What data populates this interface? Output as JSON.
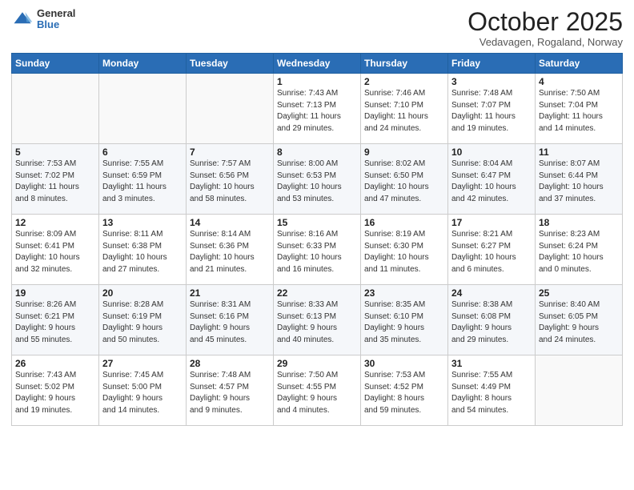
{
  "header": {
    "logo_general": "General",
    "logo_blue": "Blue",
    "month": "October 2025",
    "location": "Vedavagen, Rogaland, Norway"
  },
  "days_of_week": [
    "Sunday",
    "Monday",
    "Tuesday",
    "Wednesday",
    "Thursday",
    "Friday",
    "Saturday"
  ],
  "weeks": [
    [
      {
        "day": "",
        "info": ""
      },
      {
        "day": "",
        "info": ""
      },
      {
        "day": "",
        "info": ""
      },
      {
        "day": "1",
        "info": "Sunrise: 7:43 AM\nSunset: 7:13 PM\nDaylight: 11 hours\nand 29 minutes."
      },
      {
        "day": "2",
        "info": "Sunrise: 7:46 AM\nSunset: 7:10 PM\nDaylight: 11 hours\nand 24 minutes."
      },
      {
        "day": "3",
        "info": "Sunrise: 7:48 AM\nSunset: 7:07 PM\nDaylight: 11 hours\nand 19 minutes."
      },
      {
        "day": "4",
        "info": "Sunrise: 7:50 AM\nSunset: 7:04 PM\nDaylight: 11 hours\nand 14 minutes."
      }
    ],
    [
      {
        "day": "5",
        "info": "Sunrise: 7:53 AM\nSunset: 7:02 PM\nDaylight: 11 hours\nand 8 minutes."
      },
      {
        "day": "6",
        "info": "Sunrise: 7:55 AM\nSunset: 6:59 PM\nDaylight: 11 hours\nand 3 minutes."
      },
      {
        "day": "7",
        "info": "Sunrise: 7:57 AM\nSunset: 6:56 PM\nDaylight: 10 hours\nand 58 minutes."
      },
      {
        "day": "8",
        "info": "Sunrise: 8:00 AM\nSunset: 6:53 PM\nDaylight: 10 hours\nand 53 minutes."
      },
      {
        "day": "9",
        "info": "Sunrise: 8:02 AM\nSunset: 6:50 PM\nDaylight: 10 hours\nand 47 minutes."
      },
      {
        "day": "10",
        "info": "Sunrise: 8:04 AM\nSunset: 6:47 PM\nDaylight: 10 hours\nand 42 minutes."
      },
      {
        "day": "11",
        "info": "Sunrise: 8:07 AM\nSunset: 6:44 PM\nDaylight: 10 hours\nand 37 minutes."
      }
    ],
    [
      {
        "day": "12",
        "info": "Sunrise: 8:09 AM\nSunset: 6:41 PM\nDaylight: 10 hours\nand 32 minutes."
      },
      {
        "day": "13",
        "info": "Sunrise: 8:11 AM\nSunset: 6:38 PM\nDaylight: 10 hours\nand 27 minutes."
      },
      {
        "day": "14",
        "info": "Sunrise: 8:14 AM\nSunset: 6:36 PM\nDaylight: 10 hours\nand 21 minutes."
      },
      {
        "day": "15",
        "info": "Sunrise: 8:16 AM\nSunset: 6:33 PM\nDaylight: 10 hours\nand 16 minutes."
      },
      {
        "day": "16",
        "info": "Sunrise: 8:19 AM\nSunset: 6:30 PM\nDaylight: 10 hours\nand 11 minutes."
      },
      {
        "day": "17",
        "info": "Sunrise: 8:21 AM\nSunset: 6:27 PM\nDaylight: 10 hours\nand 6 minutes."
      },
      {
        "day": "18",
        "info": "Sunrise: 8:23 AM\nSunset: 6:24 PM\nDaylight: 10 hours\nand 0 minutes."
      }
    ],
    [
      {
        "day": "19",
        "info": "Sunrise: 8:26 AM\nSunset: 6:21 PM\nDaylight: 9 hours\nand 55 minutes."
      },
      {
        "day": "20",
        "info": "Sunrise: 8:28 AM\nSunset: 6:19 PM\nDaylight: 9 hours\nand 50 minutes."
      },
      {
        "day": "21",
        "info": "Sunrise: 8:31 AM\nSunset: 6:16 PM\nDaylight: 9 hours\nand 45 minutes."
      },
      {
        "day": "22",
        "info": "Sunrise: 8:33 AM\nSunset: 6:13 PM\nDaylight: 9 hours\nand 40 minutes."
      },
      {
        "day": "23",
        "info": "Sunrise: 8:35 AM\nSunset: 6:10 PM\nDaylight: 9 hours\nand 35 minutes."
      },
      {
        "day": "24",
        "info": "Sunrise: 8:38 AM\nSunset: 6:08 PM\nDaylight: 9 hours\nand 29 minutes."
      },
      {
        "day": "25",
        "info": "Sunrise: 8:40 AM\nSunset: 6:05 PM\nDaylight: 9 hours\nand 24 minutes."
      }
    ],
    [
      {
        "day": "26",
        "info": "Sunrise: 7:43 AM\nSunset: 5:02 PM\nDaylight: 9 hours\nand 19 minutes."
      },
      {
        "day": "27",
        "info": "Sunrise: 7:45 AM\nSunset: 5:00 PM\nDaylight: 9 hours\nand 14 minutes."
      },
      {
        "day": "28",
        "info": "Sunrise: 7:48 AM\nSunset: 4:57 PM\nDaylight: 9 hours\nand 9 minutes."
      },
      {
        "day": "29",
        "info": "Sunrise: 7:50 AM\nSunset: 4:55 PM\nDaylight: 9 hours\nand 4 minutes."
      },
      {
        "day": "30",
        "info": "Sunrise: 7:53 AM\nSunset: 4:52 PM\nDaylight: 8 hours\nand 59 minutes."
      },
      {
        "day": "31",
        "info": "Sunrise: 7:55 AM\nSunset: 4:49 PM\nDaylight: 8 hours\nand 54 minutes."
      },
      {
        "day": "",
        "info": ""
      }
    ]
  ]
}
